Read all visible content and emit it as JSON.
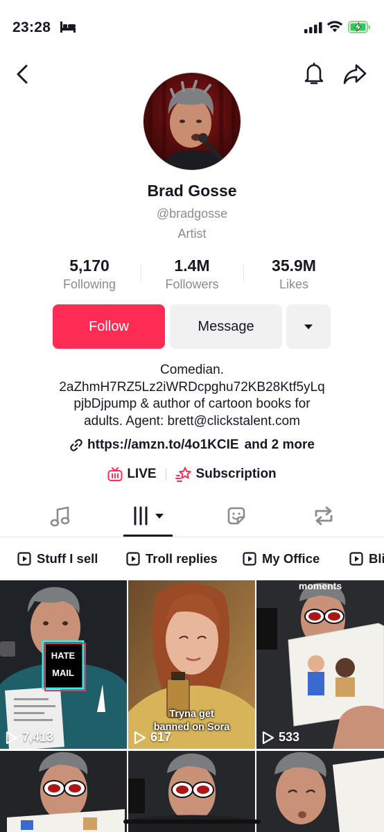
{
  "status_bar": {
    "time": "23:28"
  },
  "profile": {
    "name": "Brad Gosse",
    "handle": "@bradgosse",
    "category": "Artist"
  },
  "stats": [
    {
      "value": "5,170",
      "label": "Following"
    },
    {
      "value": "1.4M",
      "label": "Followers"
    },
    {
      "value": "35.9M",
      "label": "Likes"
    }
  ],
  "actions": {
    "follow": "Follow",
    "message": "Message"
  },
  "bio": {
    "lines": [
      "Comedian.",
      "2aZhmH7RZ5Lz2iWRDcpghu72KB28Ktf5yLq",
      "pjbDjpump & author of cartoon books for",
      "adults. Agent: brett@clickstalent.com"
    ]
  },
  "links": {
    "url": "https://amzn.to/4o1KCIE",
    "more": "and 2 more"
  },
  "badges": {
    "live": "LIVE",
    "subscription": "Subscription"
  },
  "playlists": [
    "Stuff I sell",
    "Troll replies",
    "My Office",
    "Bli"
  ],
  "videos": [
    {
      "views": "7,413",
      "caption_lines": [
        "HATE",
        "MAIL"
      ]
    },
    {
      "views": "617",
      "caption_lines": [
        "Tryna get",
        "banned on Sora"
      ]
    },
    {
      "views": "533",
      "caption_lines": [
        "moments"
      ]
    }
  ],
  "colors": {
    "accent": "#fe2c55",
    "secondary_bg": "#f1f1f2",
    "muted_text": "#8a8b91"
  }
}
